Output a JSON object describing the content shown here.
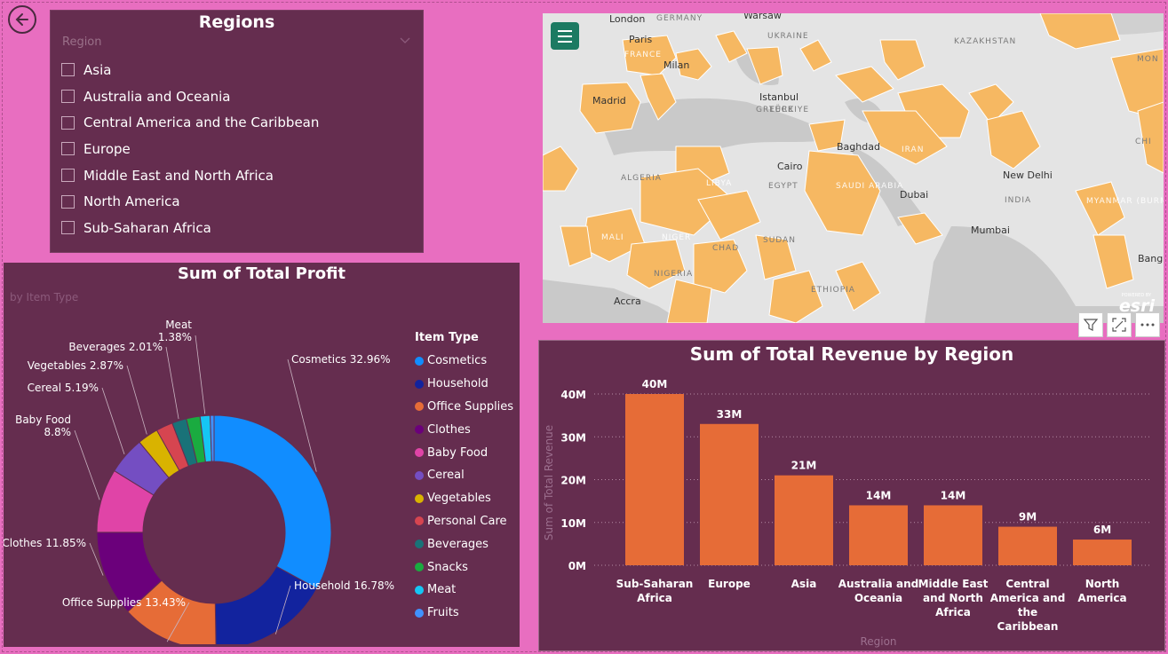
{
  "slicer": {
    "title": "Regions",
    "header": "Region",
    "items": [
      {
        "label": "Asia",
        "checked": false
      },
      {
        "label": "Australia and Oceania",
        "checked": false
      },
      {
        "label": "Central America and the Caribbean",
        "checked": false
      },
      {
        "label": "Europe",
        "checked": false
      },
      {
        "label": "Middle East and North Africa",
        "checked": false
      },
      {
        "label": "North America",
        "checked": false
      },
      {
        "label": "Sub-Saharan Africa",
        "checked": false
      }
    ]
  },
  "donut": {
    "title": "Sum of Total Profit",
    "subtitle": "by Item Type",
    "legend_title": "Item Type"
  },
  "map": {
    "labels": [
      "London",
      "GERMANY",
      "Warsaw",
      "Paris",
      "FRANCE",
      "Milan",
      "UKRAINE",
      "KAZAKHSTAN",
      "MON",
      "Madrid",
      "Istanbul",
      "TÜRKIYE",
      "GREECE",
      "Baghdad",
      "IRAN",
      "CHI",
      "Cairo",
      "EGYPT",
      "LIBYA",
      "ALGERIA",
      "SAUDI ARABIA",
      "Dubai",
      "New Delhi",
      "INDIA",
      "MYANMAR (BURMA)",
      "MALI",
      "NIGER",
      "CHAD",
      "SUDAN",
      "Mumbai",
      "Bangko",
      "NIGERIA",
      "ETHIOPIA",
      "Accra"
    ],
    "attribution": "esri",
    "attribution_small": "POWERED BY"
  },
  "toolbar": {
    "filter_icon": "filter-icon",
    "focus_icon": "focus-mode-icon",
    "more_icon": "more-options-icon"
  },
  "chart_data": [
    {
      "type": "pie",
      "title": "Sum of Total Profit",
      "subtitle": "by Item Type",
      "legend_title": "Item Type",
      "legend_position": "right",
      "categories": [
        "Cosmetics",
        "Household",
        "Office Supplies",
        "Clothes",
        "Baby Food",
        "Cereal",
        "Vegetables",
        "Personal Care",
        "Beverages",
        "Snacks",
        "Meat",
        "Fruits"
      ],
      "values": [
        32.96,
        16.78,
        13.43,
        11.85,
        8.8,
        5.19,
        2.87,
        2.3,
        2.01,
        1.9,
        1.38,
        0.53
      ],
      "colors": [
        "#118dff",
        "#12239e",
        "#e66c37",
        "#6b007b",
        "#e044a7",
        "#744ec2",
        "#d9b300",
        "#d64550",
        "#197278",
        "#1aab40",
        "#15c6f4",
        "#4092ff"
      ],
      "data_labels": [
        {
          "category": "Cosmetics",
          "text": "Cosmetics 32.96%"
        },
        {
          "category": "Household",
          "text": "Household 16.78%"
        },
        {
          "category": "Office Supplies",
          "text": "Office Supplies 13.43%"
        },
        {
          "category": "Clothes",
          "text": "Clothes 11.85%"
        },
        {
          "category": "Baby Food",
          "text": "Baby Food 8.8%"
        },
        {
          "category": "Cereal",
          "text": "Cereal 5.19%"
        },
        {
          "category": "Vegetables",
          "text": "Vegetables 2.87%"
        },
        {
          "category": "Beverages",
          "text": "Beverages 2.01%"
        },
        {
          "category": "Meat",
          "text": "Meat 1.38%"
        }
      ]
    },
    {
      "type": "bar",
      "title": "Sum of Total Revenue by Region",
      "xlabel": "Region",
      "ylabel": "Sum of Total Revenue",
      "categories": [
        "Sub-Saharan Africa",
        "Europe",
        "Asia",
        "Australia and Oceania",
        "Middle East and North Africa",
        "Central America and the Caribbean",
        "North America"
      ],
      "values": [
        40,
        33,
        21,
        14,
        14,
        9,
        6
      ],
      "value_labels": [
        "40M",
        "33M",
        "21M",
        "14M",
        "14M",
        "9M",
        "6M"
      ],
      "yticks": [
        "0M",
        "10M",
        "20M",
        "30M",
        "40M"
      ],
      "ylim": [
        0,
        40
      ],
      "color": "#e66c37",
      "grid": true
    }
  ]
}
